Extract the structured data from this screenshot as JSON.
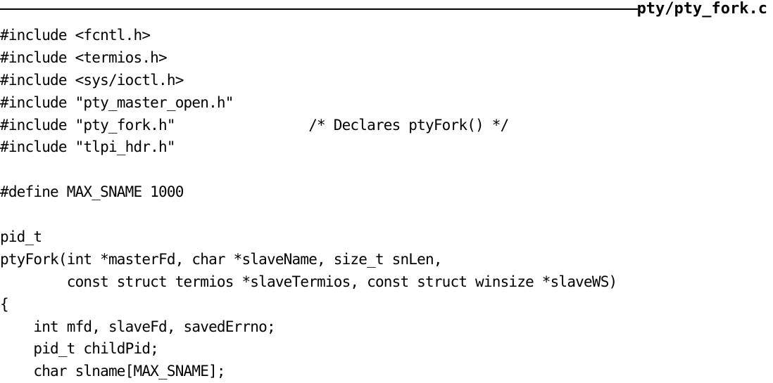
{
  "header": {
    "filename": "pty/pty_fork.c"
  },
  "code_lines": [
    "#include <fcntl.h>",
    "#include <termios.h>",
    "#include <sys/ioctl.h>",
    "#include \"pty_master_open.h\"",
    "#include \"pty_fork.h\"                /* Declares ptyFork() */",
    "#include \"tlpi_hdr.h\"",
    "",
    "#define MAX_SNAME 1000",
    "",
    "pid_t",
    "ptyFork(int *masterFd, char *slaveName, size_t snLen,",
    "        const struct termios *slaveTermios, const struct winsize *slaveWS)",
    "{",
    "    int mfd, slaveFd, savedErrno;",
    "    pid_t childPid;",
    "    char slname[MAX_SNAME];"
  ]
}
